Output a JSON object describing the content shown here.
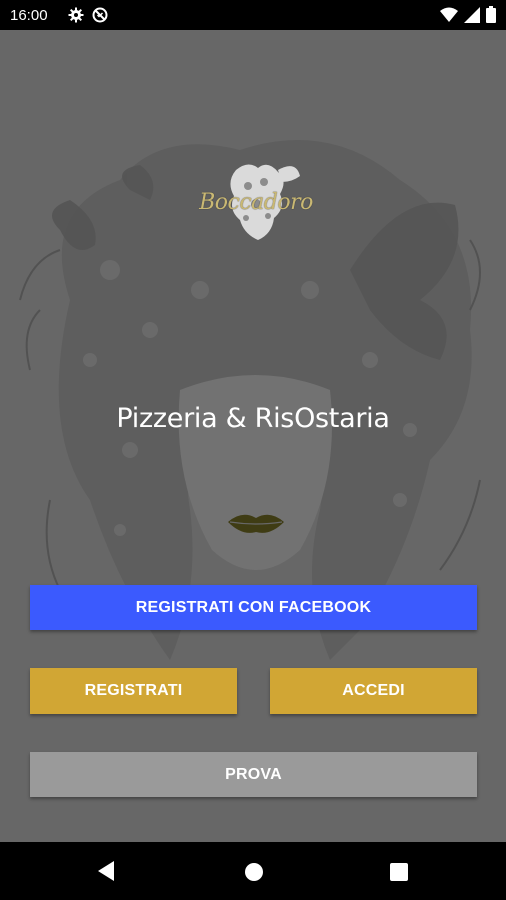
{
  "status_bar": {
    "time": "16:00",
    "icons_left": [
      "gear-icon",
      "do-not-disturb-icon"
    ],
    "icons_right": [
      "wifi-icon",
      "signal-icon",
      "battery-icon"
    ]
  },
  "app": {
    "logo_text": "Boccadoro",
    "tagline": "Pizzeria & RisOstaria",
    "buttons": {
      "facebook": "REGISTRATI CON FACEBOOK",
      "register": "REGISTRATI",
      "login": "ACCEDI",
      "try": "PROVA"
    },
    "colors": {
      "background": "#676767",
      "facebook": "#3b5afe",
      "gold": "#d1a634",
      "try": "#9a9a9a"
    }
  },
  "nav_bar": {
    "icons": [
      "back-icon",
      "home-icon",
      "recents-icon"
    ]
  }
}
